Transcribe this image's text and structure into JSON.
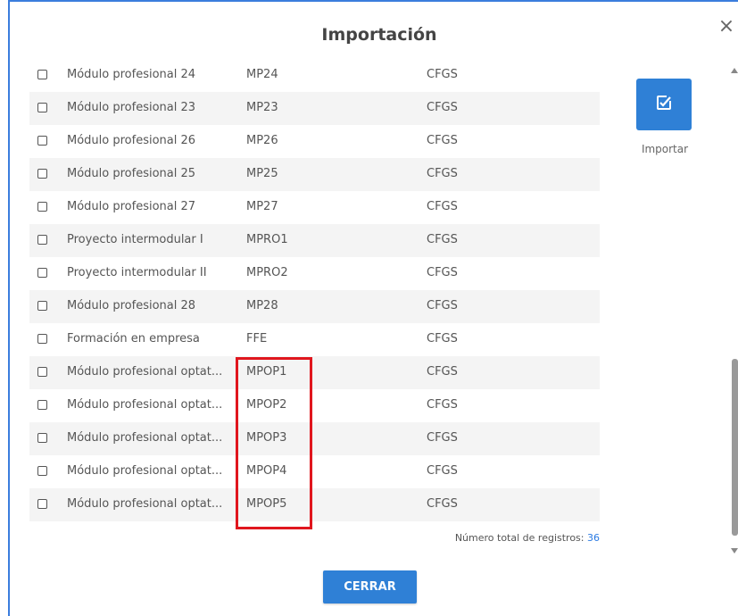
{
  "dialog": {
    "title": "Importación",
    "close_icon": "close-icon",
    "close_glyph": "×"
  },
  "table": {
    "rows": [
      {
        "name": "Módulo profesional 24",
        "code": "MP24",
        "type": "CFGS",
        "checked": false
      },
      {
        "name": "Módulo profesional 23",
        "code": "MP23",
        "type": "CFGS",
        "checked": false
      },
      {
        "name": "Módulo profesional 26",
        "code": "MP26",
        "type": "CFGS",
        "checked": false
      },
      {
        "name": "Módulo profesional 25",
        "code": "MP25",
        "type": "CFGS",
        "checked": false
      },
      {
        "name": "Módulo profesional 27",
        "code": "MP27",
        "type": "CFGS",
        "checked": false
      },
      {
        "name": "Proyecto intermodular I",
        "code": "MPRO1",
        "type": "CFGS",
        "checked": false
      },
      {
        "name": "Proyecto intermodular II",
        "code": "MPRO2",
        "type": "CFGS",
        "checked": false
      },
      {
        "name": "Módulo profesional 28",
        "code": "MP28",
        "type": "CFGS",
        "checked": false
      },
      {
        "name": "Formación en empresa",
        "code": "FFE",
        "type": "CFGS",
        "checked": false
      },
      {
        "name": "Módulo profesional optat...",
        "code": "MPOP1",
        "type": "CFGS",
        "checked": false
      },
      {
        "name": "Módulo profesional optat...",
        "code": "MPOP2",
        "type": "CFGS",
        "checked": false
      },
      {
        "name": "Módulo profesional optat...",
        "code": "MPOP3",
        "type": "CFGS",
        "checked": false
      },
      {
        "name": "Módulo profesional optat...",
        "code": "MPOP4",
        "type": "CFGS",
        "checked": false
      },
      {
        "name": "Módulo profesional optat...",
        "code": "MPOP5",
        "type": "CFGS",
        "checked": false
      }
    ]
  },
  "footer": {
    "total_label": "Número total de registros:",
    "total_value": "36"
  },
  "actions": {
    "import_label": "Importar",
    "import_icon": "edit-checkbox-icon",
    "close_label": "CERRAR"
  },
  "colors": {
    "accent": "#2f80d6",
    "highlight": "#e0161e",
    "frame": "#3b7ddd"
  }
}
